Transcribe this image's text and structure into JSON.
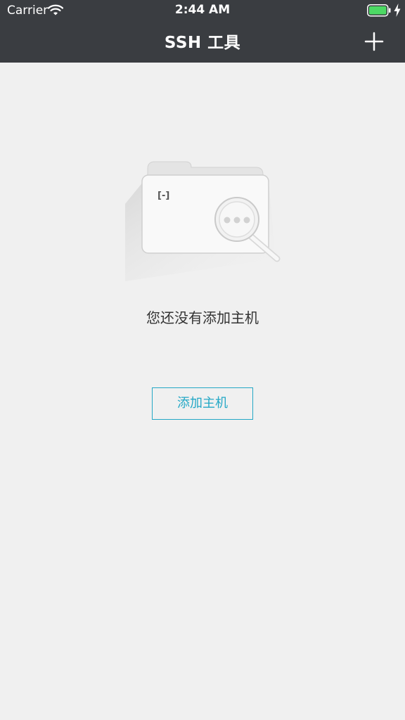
{
  "status_bar": {
    "carrier": "Carrier",
    "time": "2:44 AM"
  },
  "nav": {
    "title": "SSH 工具"
  },
  "empty_state": {
    "message": "您还没有添加主机",
    "button_label": "添加主机"
  },
  "colors": {
    "header_bg": "#3a3d41",
    "accent": "#24a8c6",
    "page_bg": "#f0f0f0",
    "battery_green": "#4cd964"
  },
  "icons": {
    "wifi": "wifi-icon",
    "battery": "battery-icon",
    "charging": "charging-bolt-icon",
    "add": "plus-icon",
    "empty": "empty-folder-search-icon"
  }
}
